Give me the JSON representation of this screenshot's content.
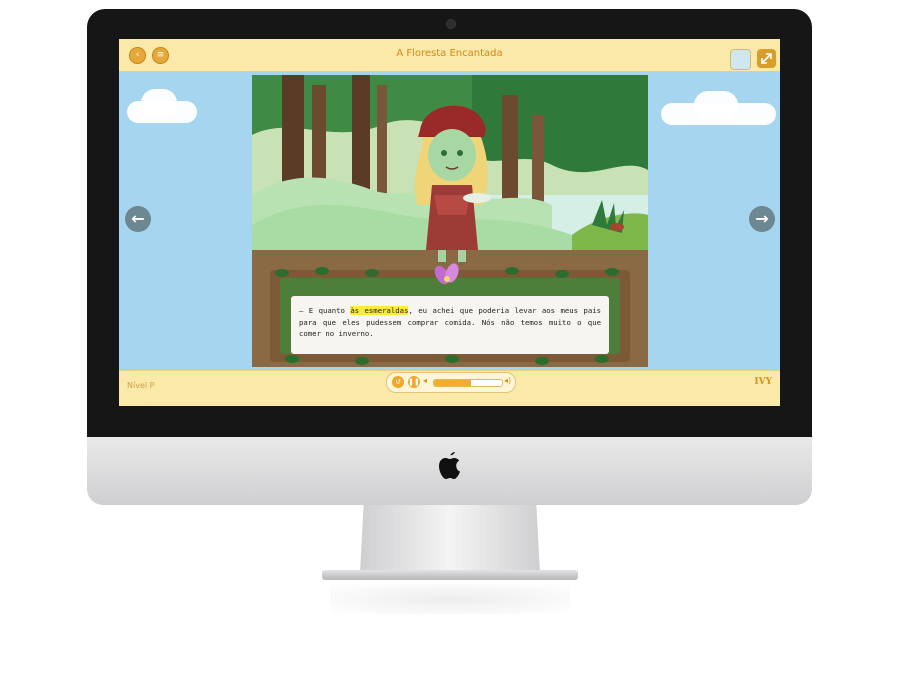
{
  "app": {
    "title": "A Floresta Encantada"
  },
  "toolbar": {
    "back_icon": "back-arrow-icon",
    "menu_icon": "menu-icon",
    "fullscreen_icon": "expand-icon"
  },
  "story": {
    "before": "— E quanto ",
    "highlight": "às esmeraldas",
    "after": ", eu achei que poderia levar aos meus pais para que eles pudessem comprar comida. Nós não temos muito o que comer no inverno."
  },
  "footer": {
    "level": "Nível P",
    "brand": "IVY"
  },
  "player": {
    "progress": 0.55
  },
  "colors": {
    "accent": "#f3ad2b",
    "bar": "#fbe9aa",
    "sky": "#a6d6ef"
  }
}
